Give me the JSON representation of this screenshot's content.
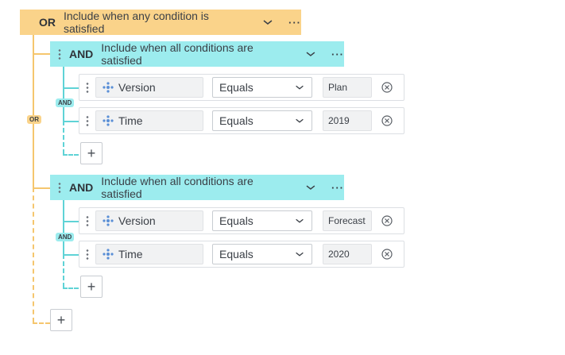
{
  "or_group": {
    "keyword": "OR",
    "description": "Include when any condition is satisfied",
    "menu": "···",
    "badge": "OR",
    "add": "+"
  },
  "and_groups": [
    {
      "keyword": "AND",
      "description": "Include when all conditions are satisfied",
      "menu": "···",
      "badge": "AND",
      "add": "+",
      "rows": [
        {
          "field": "Version",
          "operator": "Equals",
          "value": "Plan"
        },
        {
          "field": "Time",
          "operator": "Equals",
          "value": "2019"
        }
      ]
    },
    {
      "keyword": "AND",
      "description": "Include when all conditions are satisfied",
      "menu": "···",
      "badge": "AND",
      "add": "+",
      "rows": [
        {
          "field": "Version",
          "operator": "Equals",
          "value": "Forecast"
        },
        {
          "field": "Time",
          "operator": "Equals",
          "value": "2020"
        }
      ]
    }
  ],
  "colors": {
    "or_accent": "#fad38a",
    "and_accent": "#9cecee"
  },
  "icons": {
    "field": "dimension-icon",
    "remove": "clear-icon",
    "dropdown": "chevron-down-icon",
    "drag": "drag-handle-icon"
  }
}
